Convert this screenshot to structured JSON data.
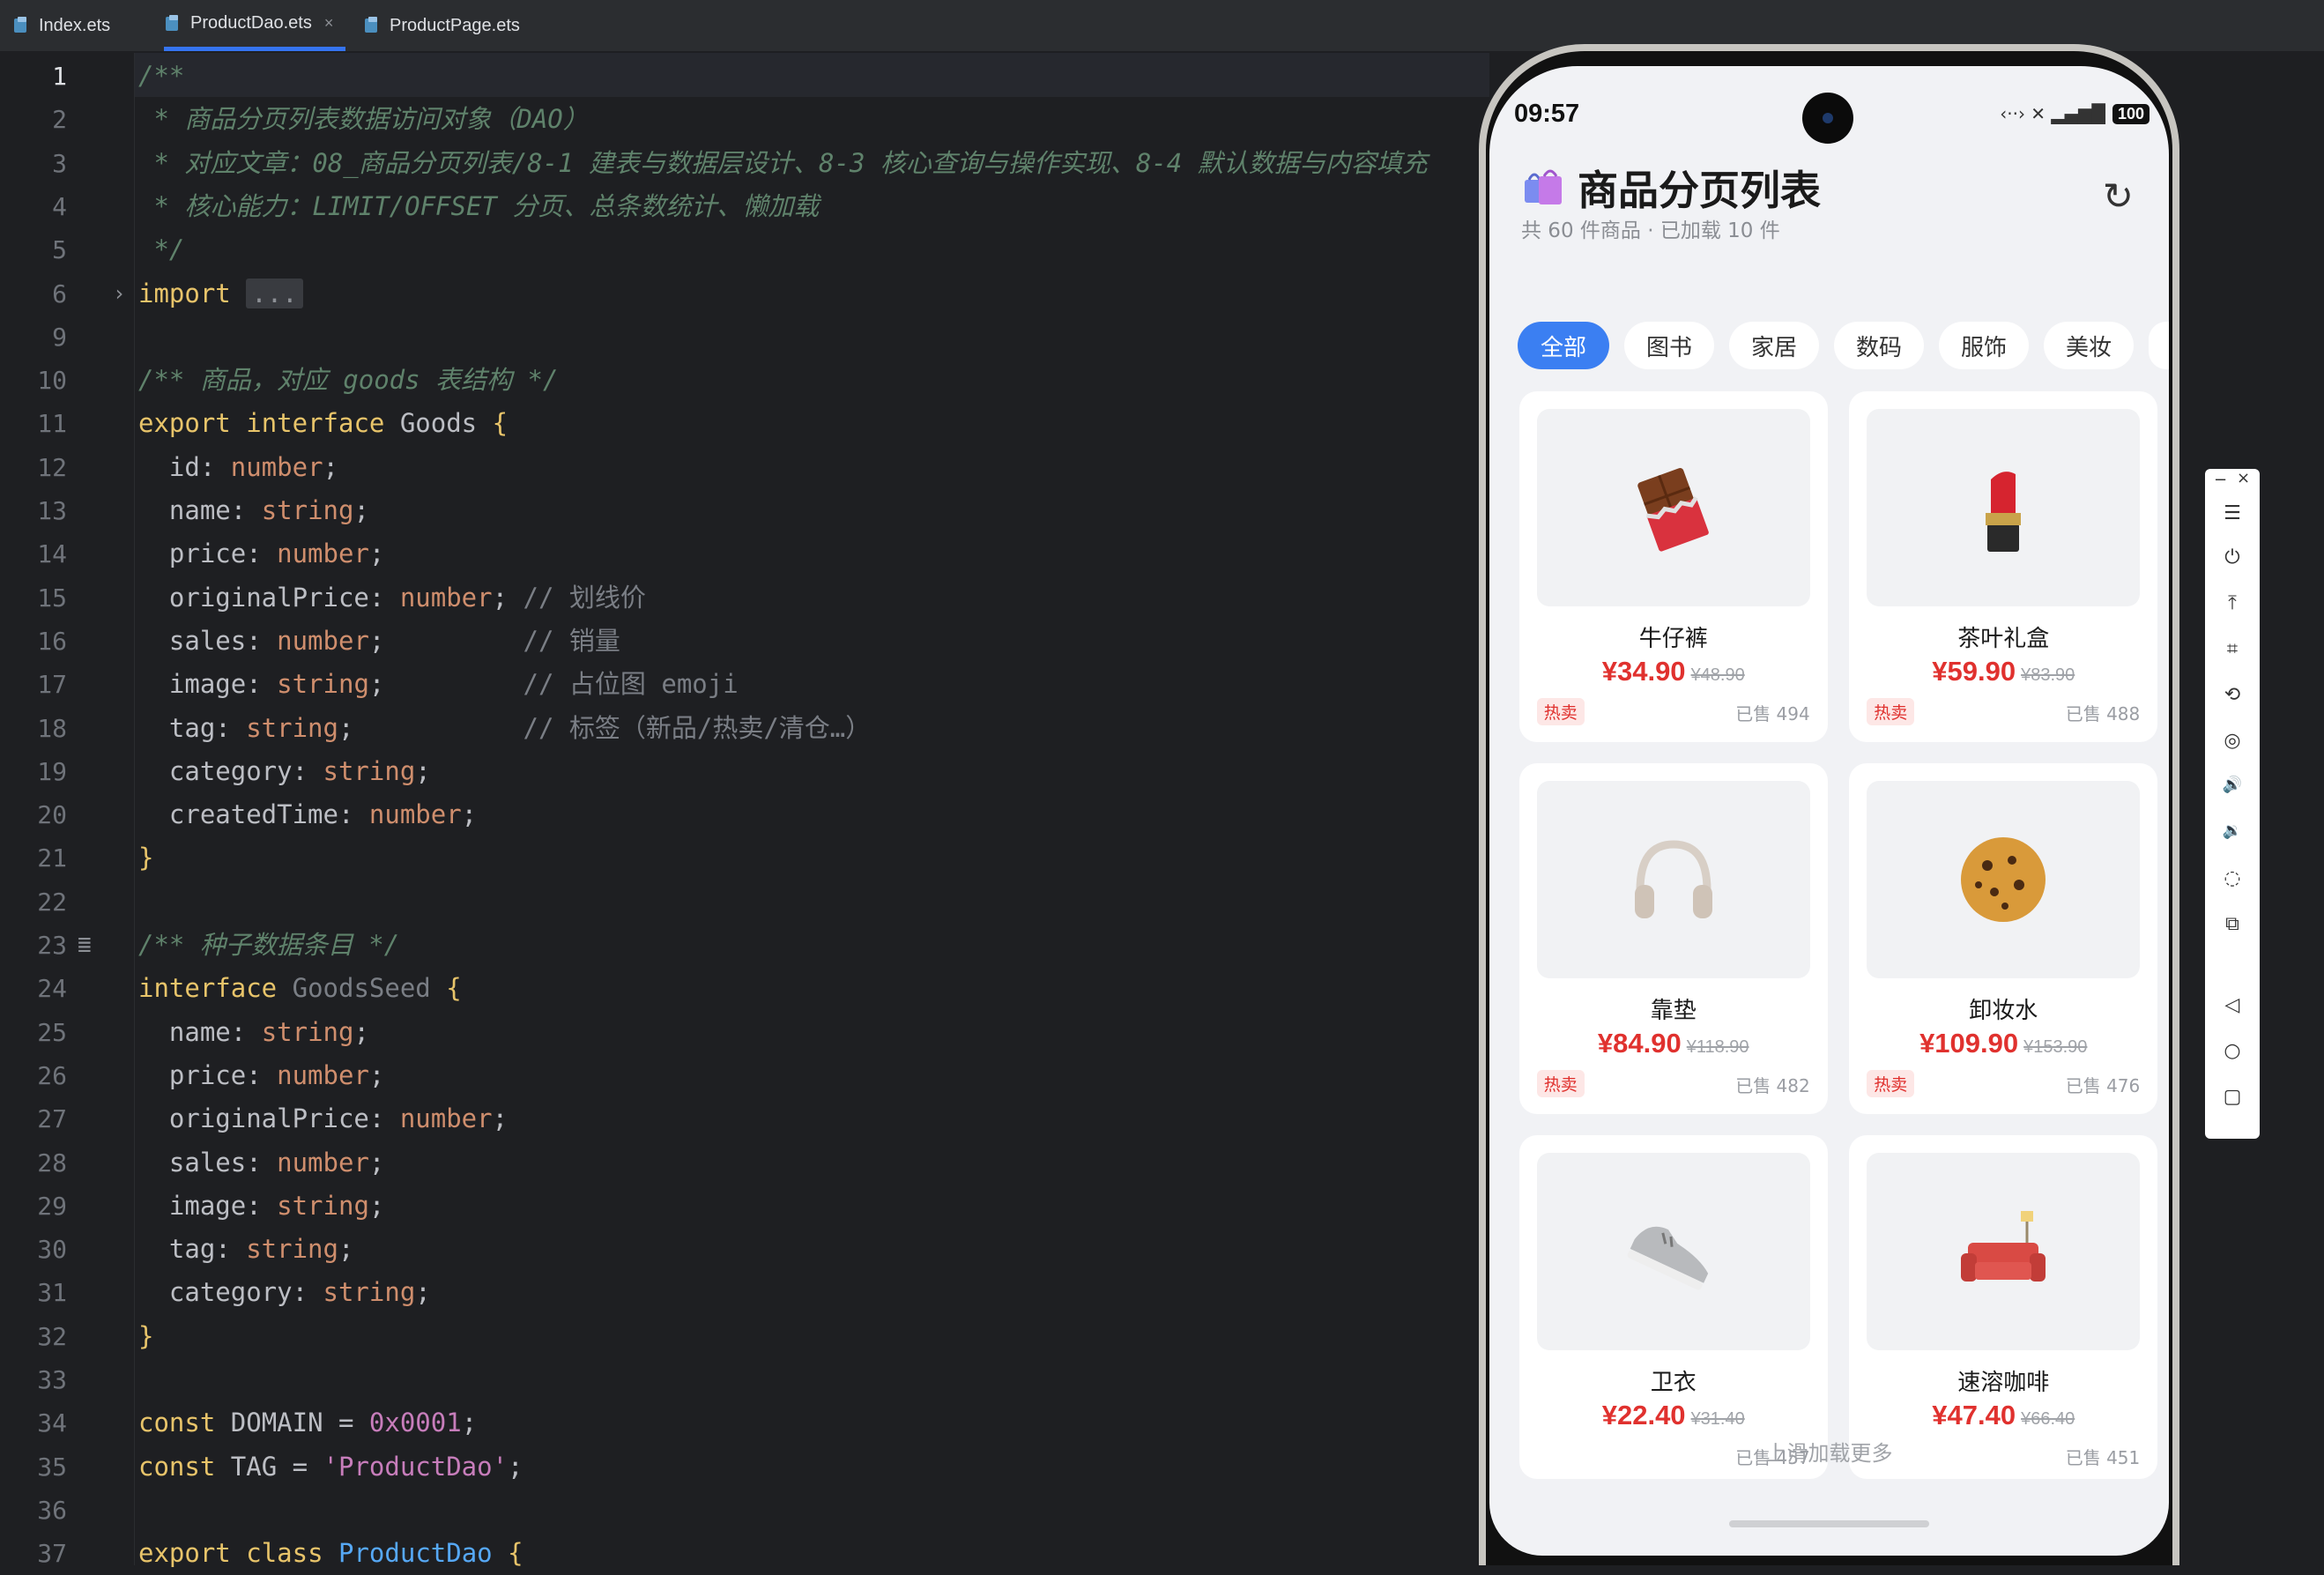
{
  "tabs": [
    {
      "label": "Index.ets",
      "active": false
    },
    {
      "label": "ProductDao.ets",
      "active": true,
      "close": "×"
    },
    {
      "label": "ProductPage.ets",
      "active": false
    }
  ],
  "editor": {
    "lines": [
      {
        "n": "1",
        "t": "/**"
      },
      {
        "n": "2",
        "t": " * 商品分页列表数据访问对象（DAO）"
      },
      {
        "n": "3",
        "t": " * 对应文章：08_商品分页列表/8-1 建表与数据层设计、8-3 核心查询与操作实现、8-4 默认数据与内容填充"
      },
      {
        "n": "4",
        "t": " * 核心能力：LIMIT/OFFSET 分页、总条数统计、懒加载"
      },
      {
        "n": "5",
        "t": " */"
      },
      {
        "n": "6",
        "t": "import",
        "fold": "..."
      },
      {
        "n": "9",
        "t": ""
      },
      {
        "n": "10",
        "t": "/** 商品，对应 goods 表结构 */"
      },
      {
        "n": "11",
        "t": "export interface Goods {"
      },
      {
        "n": "12",
        "t": "  id: number;"
      },
      {
        "n": "13",
        "t": "  name: string;"
      },
      {
        "n": "14",
        "t": "  price: number;"
      },
      {
        "n": "15",
        "t": "  originalPrice: number; // 划线价"
      },
      {
        "n": "16",
        "t": "  sales: number;         // 销量"
      },
      {
        "n": "17",
        "t": "  image: string;         // 占位图 emoji"
      },
      {
        "n": "18",
        "t": "  tag: string;           // 标签（新品/热卖/清仓…）"
      },
      {
        "n": "19",
        "t": "  category: string;"
      },
      {
        "n": "20",
        "t": "  createdTime: number;"
      },
      {
        "n": "21",
        "t": "}"
      },
      {
        "n": "22",
        "t": ""
      },
      {
        "n": "23",
        "t": "/** 种子数据条目 */"
      },
      {
        "n": "24",
        "t": "interface GoodsSeed {"
      },
      {
        "n": "25",
        "t": "  name: string;"
      },
      {
        "n": "26",
        "t": "  price: number;"
      },
      {
        "n": "27",
        "t": "  originalPrice: number;"
      },
      {
        "n": "28",
        "t": "  sales: number;"
      },
      {
        "n": "29",
        "t": "  image: string;"
      },
      {
        "n": "30",
        "t": "  tag: string;"
      },
      {
        "n": "31",
        "t": "  category: string;"
      },
      {
        "n": "32",
        "t": "}"
      },
      {
        "n": "33",
        "t": ""
      },
      {
        "n": "34",
        "t": "const DOMAIN = 0x0001;"
      },
      {
        "n": "35",
        "t": "const TAG = 'ProductDao';"
      },
      {
        "n": "36",
        "t": ""
      },
      {
        "n": "37",
        "t": "export class ProductDao {"
      }
    ]
  },
  "phone": {
    "time": "09:57",
    "status_icons": "‹··› ✕ ▂▄▆█",
    "battery": "100",
    "title": "商品分页列表",
    "subtitle": "共 60 件商品 · 已加载 10 件",
    "refresh_icon": "↻",
    "chips": [
      "全部",
      "图书",
      "家居",
      "数码",
      "服饰",
      "美妆"
    ],
    "active_chip": 0,
    "products": [
      {
        "name": "牛仔裤",
        "price": "¥34.90",
        "original": "¥48.90",
        "tag": "热卖",
        "sold": "已售 494",
        "image": "chocolate-icon"
      },
      {
        "name": "茶叶礼盒",
        "price": "¥59.90",
        "original": "¥83.90",
        "tag": "热卖",
        "sold": "已售 488",
        "image": "lipstick-icon"
      },
      {
        "name": "靠垫",
        "price": "¥84.90",
        "original": "¥118.90",
        "tag": "热卖",
        "sold": "已售 482",
        "image": "headphones-icon"
      },
      {
        "name": "卸妆水",
        "price": "¥109.90",
        "original": "¥153.90",
        "tag": "热卖",
        "sold": "已售 476",
        "image": "cookie-icon"
      },
      {
        "name": "卫衣",
        "price": "¥22.40",
        "original": "¥31.40",
        "tag": "",
        "sold": "已售 457",
        "image": "sneaker-icon"
      },
      {
        "name": "速溶咖啡",
        "price": "¥47.40",
        "original": "¥66.40",
        "tag": "",
        "sold": "已售 451",
        "image": "sofa-icon"
      }
    ],
    "load_more": "上滑加载更多"
  },
  "side_toolbar": {
    "minimize": "−",
    "close": "×",
    "tools": [
      "menu-icon",
      "power-icon",
      "pin-top-icon",
      "crop-icon",
      "rotate-icon",
      "screenshot-icon",
      "volume-up-icon",
      "volume-down-icon",
      "shake-icon",
      "multi-screen-icon",
      "back-icon",
      "home-icon",
      "recents-icon"
    ]
  }
}
